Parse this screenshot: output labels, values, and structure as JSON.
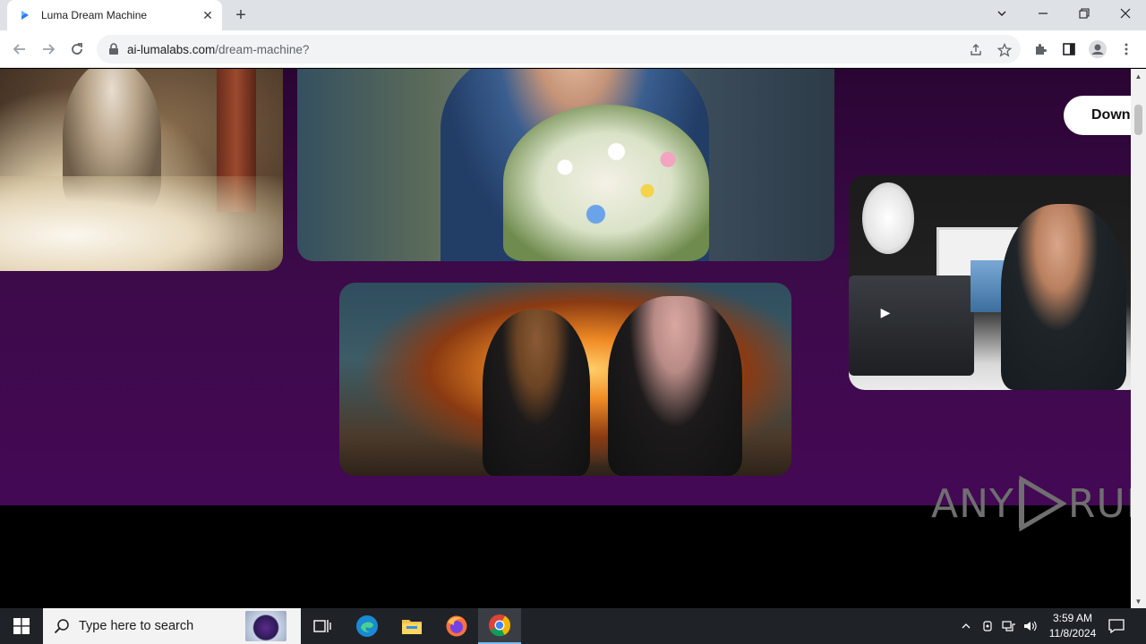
{
  "browser": {
    "tab_title": "Luma Dream Machine",
    "close_tab_symbol": "✕",
    "new_tab_symbol": "+",
    "url_domain": "ai-lumalabs.com",
    "url_path": "/dream-machine?"
  },
  "page": {
    "download_button": "Down",
    "cards": [
      {
        "name": "old-man-scene"
      },
      {
        "name": "flower-bouquet-scene"
      },
      {
        "name": "bear-and-pig-scene"
      },
      {
        "name": "photographer-scene"
      }
    ],
    "colors": {
      "background_top": "#2a0533",
      "background_bottom": "#48085a",
      "footer": "#000000"
    }
  },
  "watermark": {
    "left": "ANY",
    "right": "RUN"
  },
  "taskbar": {
    "search_placeholder": "Type here to search",
    "time": "3:59 AM",
    "date": "11/8/2024"
  }
}
